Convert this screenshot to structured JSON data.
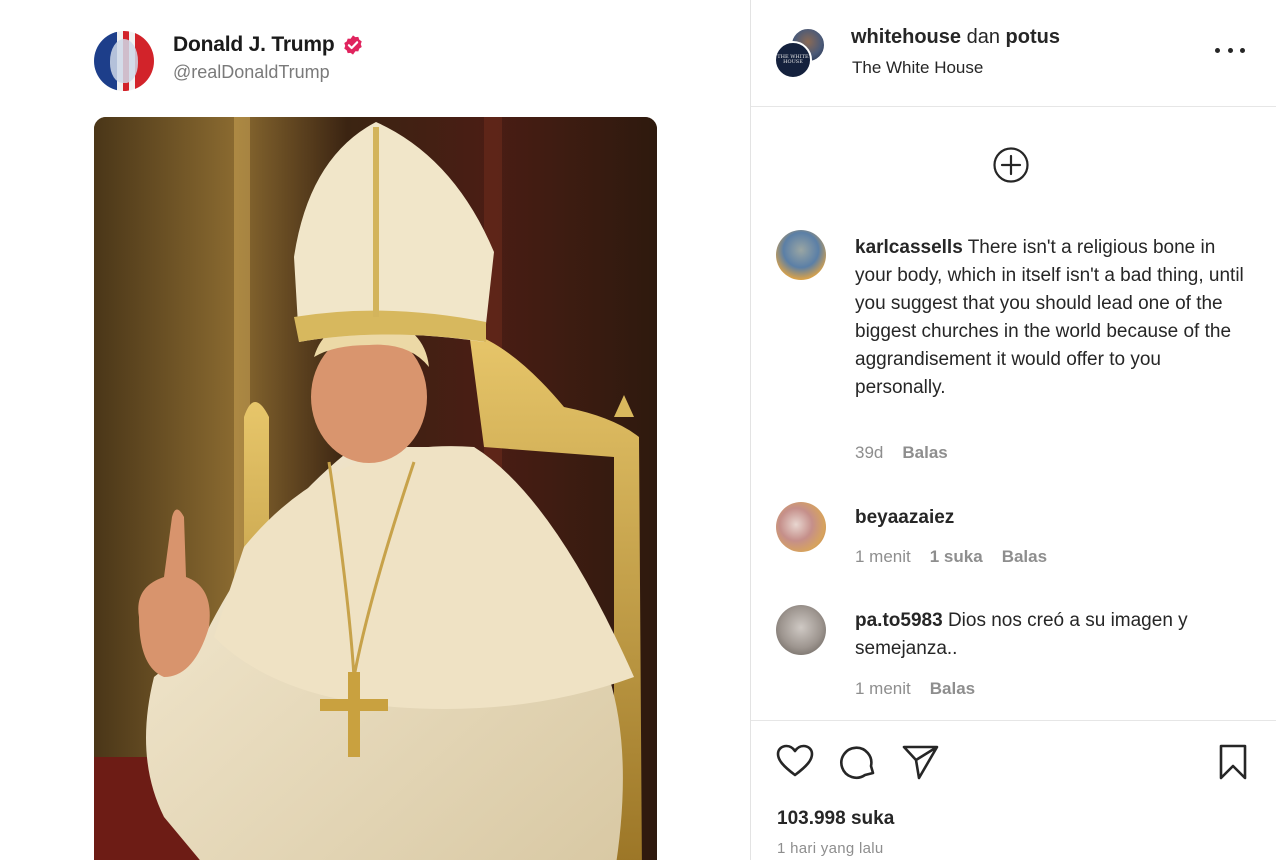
{
  "post_card": {
    "author_name": "Donald J. Trump",
    "author_handle": "@realDonaldTrump",
    "image_icon": "portrait-image"
  },
  "instagram": {
    "header": {
      "account_1": "whitehouse",
      "joiner": "dan",
      "account_2": "potus",
      "subtitle": "The White House",
      "avatar_text": "THE WHITE HOUSE"
    },
    "load_more_icon": "plus-circle-icon",
    "comments": [
      {
        "username": "karlcassells",
        "text": "There isn't a religious bone in your body, which in itself isn't a bad thing, until you suggest that you should lead one of the biggest churches in the world because of the aggrandisement it would offer to you personally.",
        "time": "39d",
        "likes": "",
        "reply": "Balas"
      },
      {
        "username": "beyaazaiez",
        "text": "",
        "time": "1 menit",
        "likes": "1 suka",
        "reply": "Balas"
      },
      {
        "username": "pa.to5983",
        "text": "Dios nos creó a su imagen y semejanza..",
        "time": "1 menit",
        "likes": "",
        "reply": "Balas"
      }
    ],
    "actions": [
      "heart-icon",
      "comment-icon",
      "share-icon",
      "bookmark-icon"
    ],
    "like_count": "103.998 suka",
    "posted": "1 hari yang lalu"
  },
  "colors": {
    "verified_badge": "#e0245e",
    "text_primary": "#262626",
    "text_secondary": "#8e8e8e",
    "border": "#e6e6e6"
  }
}
